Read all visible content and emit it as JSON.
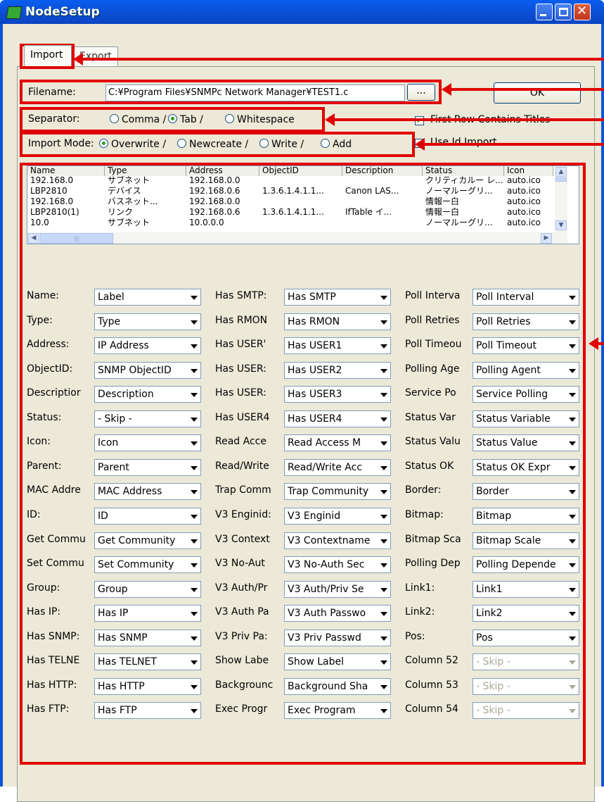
{
  "window": {
    "title": "NodeSetup"
  },
  "tabs": [
    {
      "label": "Import"
    },
    {
      "label": "Export"
    }
  ],
  "filename": {
    "label": "Filename:",
    "value": "C:¥Program Files¥SNMPc Network Manager¥TEST1.c",
    "browse": "..."
  },
  "ok_label": "OK",
  "separator": {
    "label": "Separator:",
    "options": [
      "Comma /",
      "Tab /",
      "Whitespace"
    ],
    "selected": "Tab /"
  },
  "first_row_titles": {
    "label": "First Row Contains Titles",
    "checked": true
  },
  "use_id_import": {
    "label": "Use Id Import",
    "checked": true
  },
  "import_mode": {
    "label": "Import Mode:",
    "options": [
      "Overwrite /",
      "Newcreate /",
      "Write /",
      "Add"
    ],
    "selected": "Overwrite /"
  },
  "table": {
    "columns": [
      "Name",
      "Type",
      "Address",
      "ObjectID",
      "Description",
      "Status",
      "Icon"
    ],
    "rows": [
      [
        "192.168.0",
        "サブネット",
        "192.168.0.0",
        "",
        "",
        "クリティカルー レ...",
        "auto.ico"
      ],
      [
        "LBP2810",
        "デバイス",
        "192.168.0.6",
        "1.3.6.1.4.1.1...",
        "Canon LAS...",
        "ノーマルーグリ...",
        "auto.ico"
      ],
      [
        "192.168.0",
        "バスネット...",
        "192.168.0.0",
        "",
        "",
        "情報ー白",
        "auto.ico"
      ],
      [
        "LBP2810(1)",
        "リンク",
        "192.168.0.6",
        "1.3.6.1.4.1.1...",
        "IfTable イ...",
        "情報ー白",
        "auto.ico"
      ],
      [
        "10.0",
        "サブネット",
        "10.0.0.0",
        "",
        "",
        "ノーマルーグリ...",
        "auto.ico"
      ]
    ]
  },
  "mappings": {
    "col1": [
      {
        "label": "Name:",
        "value": "Label"
      },
      {
        "label": "Type:",
        "value": "Type"
      },
      {
        "label": "Address:",
        "value": "IP Address"
      },
      {
        "label": "ObjectID:",
        "value": "SNMP ObjectID"
      },
      {
        "label": "Descriptior",
        "value": "Description"
      },
      {
        "label": "Status:",
        "value": "- Skip -"
      },
      {
        "label": "Icon:",
        "value": "Icon"
      },
      {
        "label": "Parent:",
        "value": "Parent"
      },
      {
        "label": "MAC Addre",
        "value": "MAC Address"
      },
      {
        "label": "ID:",
        "value": "ID"
      },
      {
        "label": "Get Commu",
        "value": "Get Community"
      },
      {
        "label": "Set Commu",
        "value": "Set Community"
      },
      {
        "label": "Group:",
        "value": "Group"
      },
      {
        "label": "Has IP:",
        "value": "Has IP"
      },
      {
        "label": "Has SNMP:",
        "value": "Has SNMP"
      },
      {
        "label": "Has TELNE",
        "value": "Has TELNET"
      },
      {
        "label": "Has HTTP:",
        "value": "Has HTTP"
      },
      {
        "label": "Has FTP:",
        "value": "Has FTP"
      }
    ],
    "col2": [
      {
        "label": "Has SMTP:",
        "value": "Has SMTP"
      },
      {
        "label": "Has RMON",
        "value": "Has RMON"
      },
      {
        "label": "Has USER'",
        "value": "Has USER1"
      },
      {
        "label": "Has USER:",
        "value": "Has USER2"
      },
      {
        "label": "Has USER:",
        "value": "Has USER3"
      },
      {
        "label": "Has USER4",
        "value": "Has USER4"
      },
      {
        "label": "Read Acce",
        "value": "Read Access M"
      },
      {
        "label": "Read/Write",
        "value": "Read/Write Acc"
      },
      {
        "label": "Trap Comm",
        "value": "Trap Community"
      },
      {
        "label": "V3 Enginid:",
        "value": "V3 Enginid"
      },
      {
        "label": "V3 Context",
        "value": "V3 Contextname"
      },
      {
        "label": "V3 No-Aut",
        "value": "V3 No-Auth Sec"
      },
      {
        "label": "V3 Auth/Pr",
        "value": "V3 Auth/Priv Se"
      },
      {
        "label": "V3 Auth Pa",
        "value": "V3 Auth Passwo"
      },
      {
        "label": "V3 Priv Pa:",
        "value": "V3 Priv Passwd"
      },
      {
        "label": "Show Labe",
        "value": "Show Label"
      },
      {
        "label": "Backgrounc",
        "value": "Background Sha"
      },
      {
        "label": "Exec Progr",
        "value": "Exec Program"
      }
    ],
    "col3": [
      {
        "label": "Poll Interva",
        "value": "Poll Interval"
      },
      {
        "label": "Poll Retries",
        "value": "Poll Retries"
      },
      {
        "label": "Poll Timeou",
        "value": "Poll Timeout"
      },
      {
        "label": "Polling Age",
        "value": "Polling Agent"
      },
      {
        "label": "Service Po",
        "value": "Service Polling"
      },
      {
        "label": "Status Var",
        "value": "Status Variable"
      },
      {
        "label": "Status Valu",
        "value": "Status Value"
      },
      {
        "label": "Status OK",
        "value": "Status OK Expr"
      },
      {
        "label": "Border:",
        "value": "Border"
      },
      {
        "label": "Bitmap:",
        "value": "Bitmap"
      },
      {
        "label": "Bitmap Sca",
        "value": "Bitmap Scale"
      },
      {
        "label": "Polling Dep",
        "value": "Polling Depende"
      },
      {
        "label": "Link1:",
        "value": "Link1"
      },
      {
        "label": "Link2:",
        "value": "Link2"
      },
      {
        "label": "Pos:",
        "value": "Pos"
      },
      {
        "label": "Column 52",
        "value": "- Skip -",
        "disabled": true
      },
      {
        "label": "Column 53",
        "value": "- Skip -",
        "disabled": true
      },
      {
        "label": "Column 54",
        "value": "- Skip -",
        "disabled": true
      }
    ]
  },
  "colors": {
    "title_bar": "#0a54d8",
    "client_bg": "#ece9d8",
    "annotation": "#e00000"
  }
}
